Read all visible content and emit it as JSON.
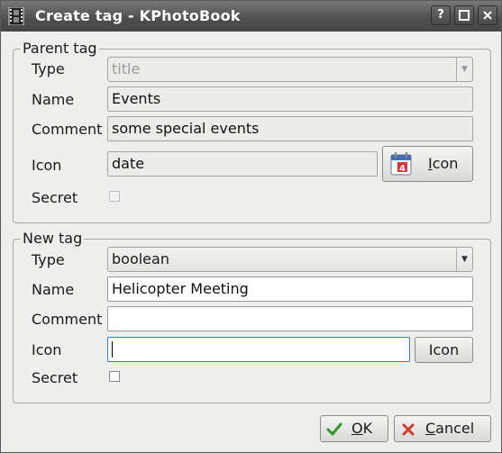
{
  "window": {
    "title": "Create tag - KPhotoBook",
    "help_label": "?",
    "maximize_label": "□",
    "close_label": "✕"
  },
  "parent_tag": {
    "legend": "Parent tag",
    "type_label": "Type",
    "type_value": "title",
    "name_label": "Name",
    "name_value": "Events",
    "comment_label": "Comment",
    "comment_value": "some special events",
    "icon_label": "Icon",
    "icon_value": "date",
    "icon_button_underlined": "I",
    "icon_button_rest": "con",
    "secret_label": "Secret",
    "secret_checked": false
  },
  "new_tag": {
    "legend": "New tag",
    "type_label": "Type",
    "type_value": "boolean",
    "name_label": "Name",
    "name_value": "Helicopter Meeting",
    "comment_label": "Comment",
    "comment_value": "",
    "icon_label": "Icon",
    "icon_value": "",
    "icon_button": "Icon",
    "secret_label": "Secret",
    "secret_checked": false
  },
  "buttons": {
    "ok_underlined": "O",
    "ok_rest": "K",
    "cancel_underlined": "C",
    "cancel_rest": "ancel"
  },
  "colors": {
    "titlebar": "#4e4e4e",
    "ok_check": "#2e9a2e",
    "cancel_x": "#d23a2a",
    "focus_border": "#3d7ac8"
  }
}
